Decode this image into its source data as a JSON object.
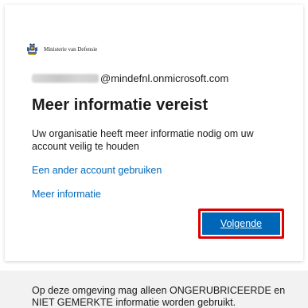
{
  "header": {
    "organization": "Ministerie van Defensie",
    "logo_icon": "royal-crest-icon"
  },
  "identity": {
    "email_domain": "@mindefnl.onmicrosoft.com"
  },
  "main": {
    "title": "Meer informatie vereist",
    "description": "Uw organisatie heeft meer informatie nodig om uw account veilig te houden",
    "use_other_account": "Een ander account gebruiken",
    "more_info": "Meer informatie",
    "next_button": "Volgende"
  },
  "footer": {
    "notice": "Op deze omgeving mag alleen ONGERUBRICEERDE en NIET GEMERKTE informatie worden gebruikt."
  },
  "colors": {
    "accent": "#0067b8",
    "highlight": "#e00000",
    "footer_bg": "#f2f2f2"
  }
}
